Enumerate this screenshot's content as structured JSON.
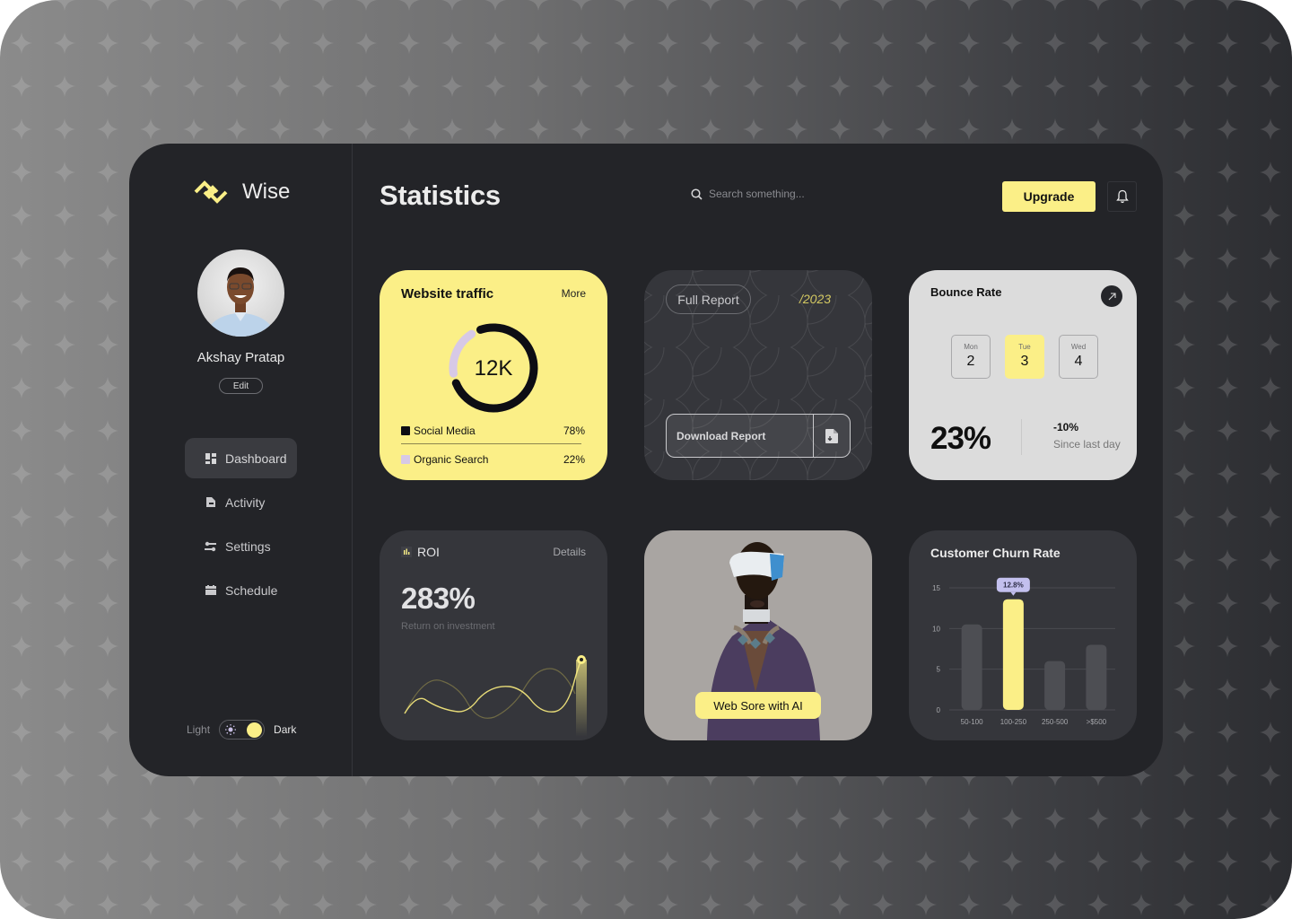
{
  "app": {
    "brand": "Wise",
    "page_title": "Statistics",
    "accent_color": "#fbef87"
  },
  "sidebar": {
    "user_name": "Akshay Pratap",
    "edit_label": "Edit",
    "items": [
      {
        "label": "Dashboard",
        "icon": "dashboard-icon",
        "active": true
      },
      {
        "label": "Activity",
        "icon": "activity-icon",
        "active": false
      },
      {
        "label": "Settings",
        "icon": "settings-sliders-icon",
        "active": false
      },
      {
        "label": "Schedule",
        "icon": "calendar-icon",
        "active": false
      }
    ],
    "theme": {
      "light_label": "Light",
      "dark_label": "Dark",
      "selected": "Dark"
    }
  },
  "header": {
    "search_placeholder": "Search something...",
    "upgrade_label": "Upgrade"
  },
  "website_traffic": {
    "title": "Website traffic",
    "more_label": "More",
    "total": "12K",
    "segments": [
      {
        "label": "Social Media",
        "percent": "78%",
        "value": 78,
        "color": "#0d0d14"
      },
      {
        "label": "Organic Search",
        "percent": "22%",
        "value": 22,
        "color": "#d7c9e6"
      }
    ]
  },
  "report": {
    "full_report_label": "Full Report",
    "year": "/2023",
    "download_label": "Download Report"
  },
  "bounce_rate": {
    "title": "Bounce Rate",
    "days": [
      {
        "name": "Mon",
        "value": "2",
        "selected": false
      },
      {
        "name": "Tue",
        "value": "3",
        "selected": true
      },
      {
        "name": "Wed",
        "value": "4",
        "selected": false
      }
    ],
    "value": "23%",
    "change": "-10%",
    "change_label": "Since last day"
  },
  "roi": {
    "title": "ROI",
    "details_label": "Details",
    "value": "283%",
    "subtitle": "Return on investment"
  },
  "ai_card": {
    "badge_label": "Web Sore with AI"
  },
  "chart_data": {
    "type": "bar",
    "title": "Customer Churn Rate",
    "categories": [
      "50-100",
      "100-250",
      "250-500",
      ">$500"
    ],
    "values": [
      10.5,
      13.6,
      6.0,
      8.0
    ],
    "highlight_index": 1,
    "highlight_label": "12.8%",
    "yticks": [
      "0",
      "5",
      "10",
      "15"
    ],
    "ylim": [
      0,
      15
    ],
    "grid": true,
    "xlabel": "",
    "ylabel": ""
  }
}
